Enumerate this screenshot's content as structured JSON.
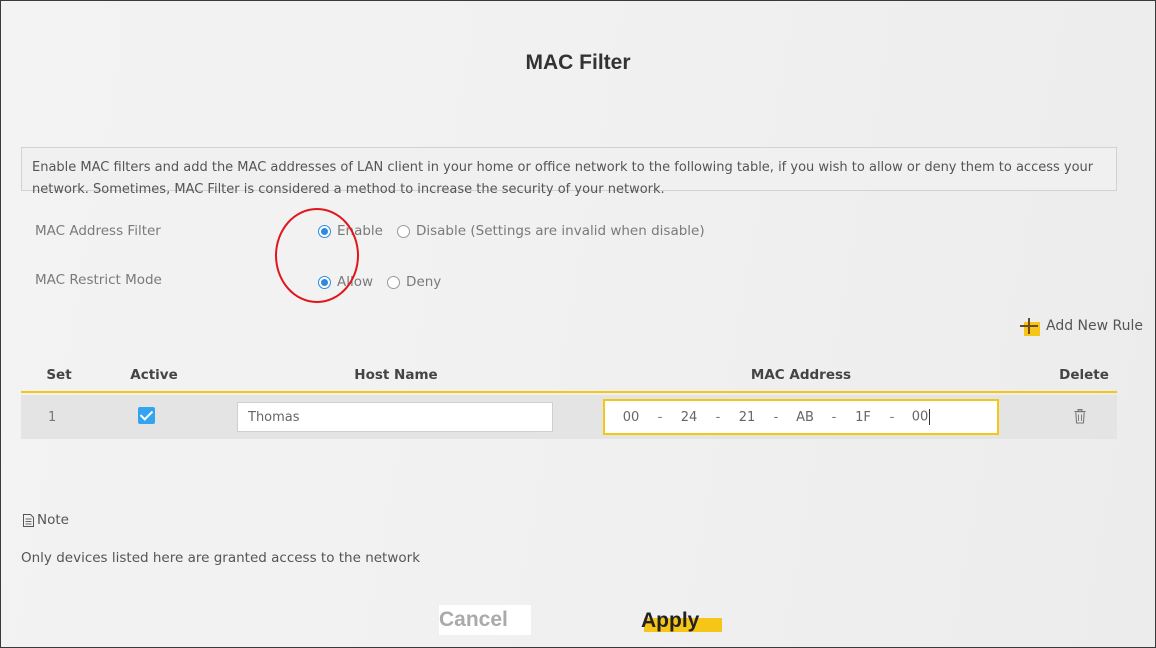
{
  "page": {
    "title": "MAC Filter"
  },
  "description": "Enable MAC filters and add the MAC addresses of LAN client in your home or office network to the following table, if you wish to allow or deny them to access your network. Sometimes, MAC Filter is considered a method to increase the security of your network.",
  "mac_address_filter": {
    "label": "MAC Address Filter",
    "options": [
      "Enable",
      "Disable (Settings are invalid when disable)"
    ],
    "selected": "Enable"
  },
  "mac_restrict_mode": {
    "label": "MAC Restrict Mode",
    "options": [
      "Allow",
      "Deny"
    ],
    "selected": "Allow"
  },
  "add_rule_label": "Add New Rule",
  "table": {
    "headers": [
      "Set",
      "Active",
      "Host Name",
      "MAC Address",
      "Delete"
    ],
    "rows": [
      {
        "set": "1",
        "active": true,
        "host_name": "Thomas",
        "mac": [
          "00",
          "24",
          "21",
          "AB",
          "1F",
          "00"
        ]
      }
    ],
    "mac_separator": "-"
  },
  "note": {
    "title": "Note",
    "text": "Only devices listed here are granted access to the network"
  },
  "buttons": {
    "cancel": "Cancel",
    "apply": "Apply"
  },
  "colors": {
    "accent": "#f5c518",
    "radio": "#2b8be0",
    "annotation": "#e0161c"
  },
  "icons": {
    "add": "plus-icon",
    "delete": "trash-icon",
    "note": "note-icon"
  }
}
